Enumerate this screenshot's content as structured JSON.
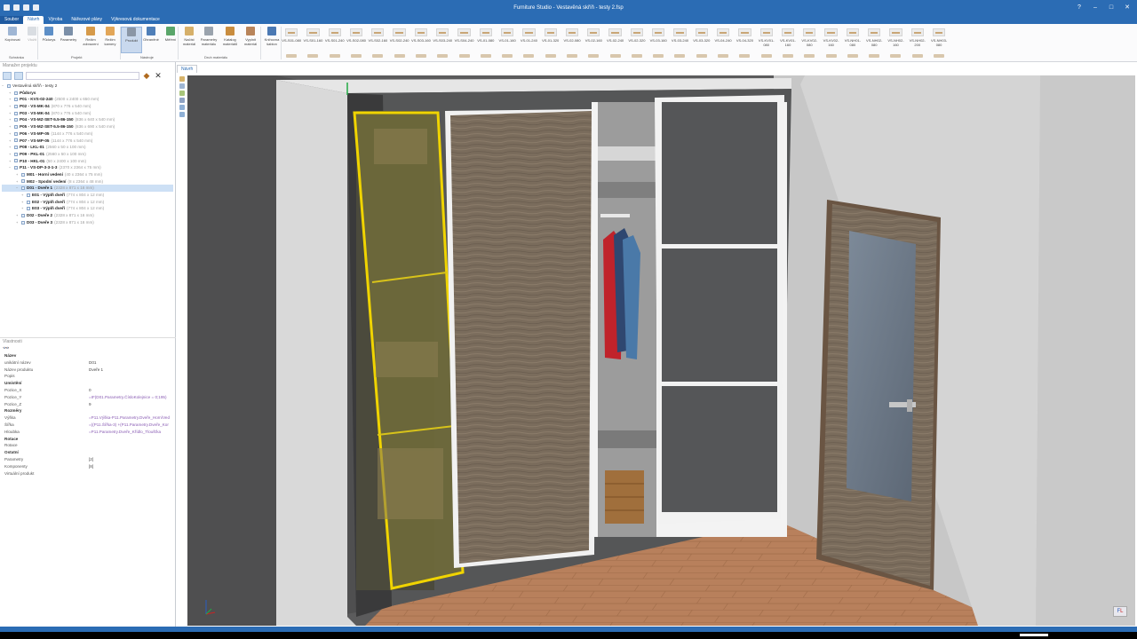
{
  "window": {
    "title": "Furniture Studio - Vestavěná skříň - testy 2.fsp"
  },
  "menu_tabs": [
    {
      "label": "Soubor"
    },
    {
      "label": "Návrh"
    },
    {
      "label": "Výroba"
    },
    {
      "label": "Nářezové plány"
    },
    {
      "label": "Výkresová dokumentace"
    }
  ],
  "ribbon": {
    "buttons": [
      {
        "label": "Kopírovat"
      },
      {
        "label": "Vložit"
      },
      {
        "label": "Půdorys"
      },
      {
        "label": "Parametry"
      },
      {
        "label": "Režim zobrazení"
      },
      {
        "label": "Režim kamery"
      },
      {
        "label": "Produkt"
      },
      {
        "label": "Ohraněné"
      },
      {
        "label": "Měření"
      },
      {
        "label": "Načíst materiál"
      },
      {
        "label": "Parametry materiálu"
      },
      {
        "label": "Katalog materiálů"
      },
      {
        "label": "Vyplnit materiál"
      },
      {
        "label": "Knihovna šablon"
      }
    ],
    "groups": [
      {
        "label": "Schránka"
      },
      {
        "label": "Projekt"
      },
      {
        "label": "Nástroje"
      },
      {
        "label": "Druh materiálu"
      }
    ],
    "parts": [
      "VS-S01-080",
      "VS-S01-160",
      "VS-S01-240",
      "VS-S02-080",
      "VS-S02-160",
      "VS-S02-240",
      "VS-S03-160",
      "VS-S03-240",
      "VS-S04-240",
      "VS-01-080",
      "VS-01-160",
      "VS-01-240",
      "VS-01-320",
      "VS-02-080",
      "VS-02-160",
      "VS-02-240",
      "VS-02-320",
      "VS-03-160",
      "VS-03-240",
      "VS-03-320",
      "VS-04-240",
      "VS-04-320",
      "VS-KV01-080",
      "VS-KV01-160",
      "VS-KV02-080",
      "VS-KV02-160",
      "VS-NH01-080",
      "VS-NH02-080",
      "VS-NH02-160",
      "VS-NH02-200",
      "VS-NH03-080"
    ]
  },
  "project_panel": {
    "title": "Manažer projektu",
    "root": "Vestavěná skříň - testy 2",
    "items": [
      {
        "label": "Půdorys",
        "size": ""
      },
      {
        "label": "P01 - KVS-02-240",
        "size": "(2500 x 2400 x 650 mm)"
      },
      {
        "label": "P02 - VS-MK-04",
        "size": "(870 x 776 x 540 mm)"
      },
      {
        "label": "P03 - VS-MK-04",
        "size": "(870 x 776 x 540 mm)"
      },
      {
        "label": "P04 - VS-MZ-SET-5.5-86-150",
        "size": "(836 x 640 x 540 mm)"
      },
      {
        "label": "P05 - VS-MZ-SET-5.5-86-150",
        "size": "(836 x 690 x 540 mm)"
      },
      {
        "label": "P06 - VS-MP-05",
        "size": "(1144 x 776 x 540 mm)"
      },
      {
        "label": "P07 - VS-MP-05",
        "size": "(1144 x 776 x 540 mm)"
      },
      {
        "label": "P08 - LKL-01",
        "size": "(2560 x 50 x 100 mm)"
      },
      {
        "label": "P09 - PKL-01",
        "size": "(2560 x 50 x 100 mm)"
      },
      {
        "label": "P10 - HKL-01",
        "size": "(50 x 2400 x 100 mm)"
      },
      {
        "label": "P11 - VS-DP-3-3-1-3",
        "size": "(2370 x 2364 x 75 mm)"
      },
      {
        "label": "M01 - Horní vedení",
        "size": "(40 x 2364 x 75 mm)"
      },
      {
        "label": "M02 - Spodní vedení",
        "size": "(8 x 2364 x 48 mm)"
      },
      {
        "label": "D01 - Dveře 1",
        "size": "(2328 x 871 x 16 mm)"
      },
      {
        "label": "E01 - Výplň dveří",
        "size": "(774 x 804 x 12 mm)"
      },
      {
        "label": "E02 - Výplň dveří",
        "size": "(774 x 804 x 12 mm)"
      },
      {
        "label": "E03 - Výplň dveří",
        "size": "(774 x 804 x 12 mm)"
      },
      {
        "label": "D02 - Dveře 2",
        "size": "(2328 x 871 x 16 mm)"
      },
      {
        "label": "D03 - Dveře 3",
        "size": "(2328 x 871 x 16 mm)"
      }
    ]
  },
  "properties_panel": {
    "title": "Vlastnosti",
    "rows": [
      {
        "key": "Název",
        "value": ""
      },
      {
        "key": "unikátní název",
        "value": "D01"
      },
      {
        "key": "Název produktu",
        "value": "Dveře 1"
      },
      {
        "key": "Popis",
        "value": ""
      },
      {
        "key": "Umístění",
        "value": ""
      },
      {
        "key": "Pozice_X",
        "value": "0"
      },
      {
        "key": "Pozice_Y",
        "value": "=IF(D01.Parametry.ČísloKolejnice = 0;195)"
      },
      {
        "key": "Pozice_Z",
        "value": "9"
      },
      {
        "key": "Rozměry",
        "value": ""
      },
      {
        "key": "Výška",
        "value": "=P11.Výška-P11.Parametry.Dveře_HorníVed"
      },
      {
        "key": "Šířka",
        "value": "=((P11.Šířka-3) +(P11.Parametry.Dveře_Kor"
      },
      {
        "key": "Hloubka",
        "value": "=P11.Parametry.Dveře_Křídlo_Tloušťka"
      },
      {
        "key": "Rotace",
        "value": ""
      },
      {
        "key": "Rotace",
        "value": ""
      },
      {
        "key": "Ostatní",
        "value": ""
      },
      {
        "key": "Parametry",
        "value": "[2]"
      },
      {
        "key": "Komponenty",
        "value": "[8]"
      },
      {
        "key": "Virtuální produkt",
        "value": ""
      }
    ]
  },
  "viewport": {
    "tab_label": "Návrh"
  },
  "colors": {
    "accent": "#2b6cb4",
    "selection": "#e8c81a",
    "wood_dark": "#6e6051",
    "panel_grey": "#5e5f61"
  }
}
